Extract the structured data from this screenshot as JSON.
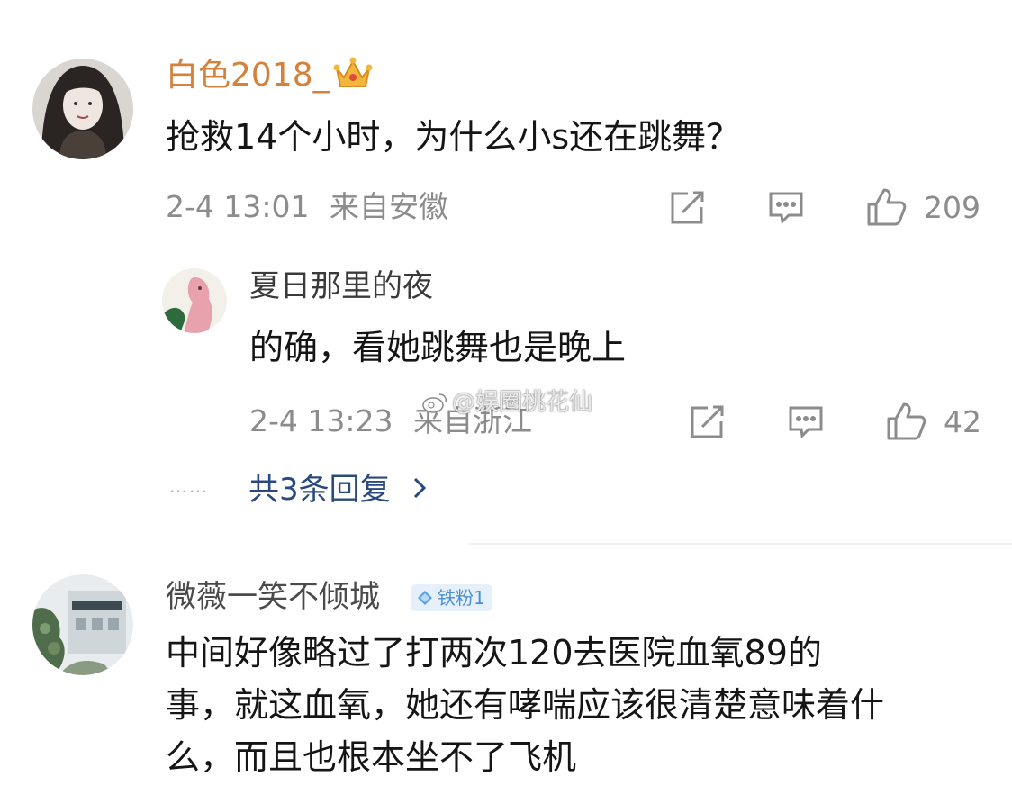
{
  "comments": [
    {
      "username": "白色2018_",
      "username_color": "#d4823a",
      "text": "抢救14个小时，为什么小s还在跳舞？",
      "time": "2-4 13:01",
      "location": "来自安徽",
      "likes": "209",
      "avatar_icon": "woman-portrait-avatar",
      "badge_icon": "crown-icon"
    },
    {
      "username": "微薇一笑不倾城",
      "username_color": "#4a4a4a",
      "badge_label": "铁粉1",
      "text_lines": [
        "中间好像略过了打两次120去医院血氧89的",
        "事，就这血氧，她还有哮喘应该很清楚意味着什",
        "么，而且也根本坐不了飞机"
      ],
      "avatar_icon": "building-photo-avatar"
    }
  ],
  "reply": {
    "username": "夏日那里的夜",
    "username_color": "#3a3a3a",
    "text": "的确，看她跳舞也是晚上",
    "time": "2-4 13:23",
    "location": "来自浙江",
    "likes": "42",
    "avatar_icon": "pink-figure-avatar"
  },
  "more_replies_label": "共3条回复",
  "more_replies_dots": "……",
  "watermark": "@娱圈桃花仙",
  "colors": {
    "meta": "#8c8c8c",
    "link": "#2a4a7f",
    "badge_bg": "#e6f0fb",
    "badge_text": "#4a8fd6"
  }
}
